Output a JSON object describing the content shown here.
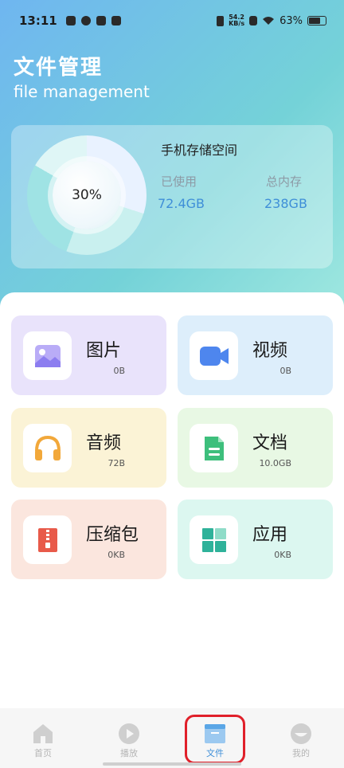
{
  "status_bar": {
    "time": "13:11",
    "net_speed_top": "54.2",
    "net_speed_bottom": "KB/s",
    "battery": "63%"
  },
  "header": {
    "title": "文件管理",
    "subtitle": "file management"
  },
  "storage": {
    "title": "手机存储空间",
    "percent": "30%",
    "used_label": "已使用",
    "used_value": "72.4GB",
    "total_label": "总内存",
    "total_value": "238GB",
    "used_fraction": 0.3
  },
  "categories": [
    {
      "name": "图片",
      "size": "0B",
      "icon": "image-icon",
      "bg": "#e9e3fb",
      "color": "#8c7df0"
    },
    {
      "name": "视频",
      "size": "0B",
      "icon": "video-icon",
      "bg": "#ddeefb",
      "color": "#4e86ee"
    },
    {
      "name": "音频",
      "size": "72B",
      "icon": "headphones-icon",
      "bg": "#fbf3d6",
      "color": "#f2a83a"
    },
    {
      "name": "文档",
      "size": "10.0GB",
      "icon": "document-icon",
      "bg": "#e8f8e4",
      "color": "#3dbf7c"
    },
    {
      "name": "压缩包",
      "size": "0KB",
      "icon": "zip-icon",
      "bg": "#fbe6de",
      "color": "#e85a4a"
    },
    {
      "name": "应用",
      "size": "0KB",
      "icon": "apps-icon",
      "bg": "#dcf7f0",
      "color": "#2fb29a"
    }
  ],
  "tabs": [
    {
      "label": "首页",
      "icon": "home-icon"
    },
    {
      "label": "播放",
      "icon": "play-icon"
    },
    {
      "label": "文件",
      "icon": "folder-icon",
      "active": true
    },
    {
      "label": "我的",
      "icon": "profile-icon"
    }
  ],
  "colors": {
    "accent": "#3f8fd8",
    "highlight": "#e0202a"
  }
}
